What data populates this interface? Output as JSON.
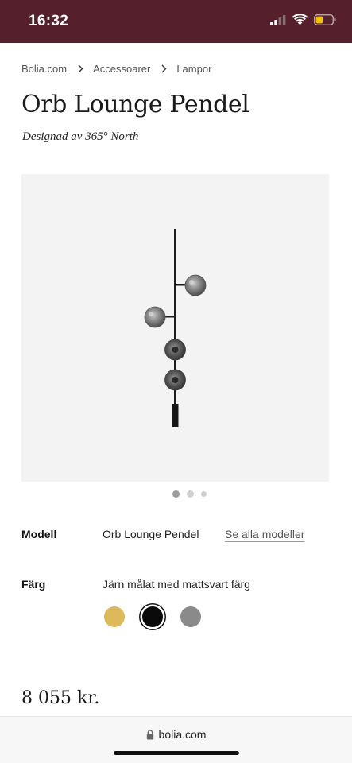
{
  "status_bar": {
    "time": "16:32",
    "battery_color": "#f2c200",
    "background": "#55202b"
  },
  "breadcrumb": {
    "items": [
      "Bolia.com",
      "Accessoarer",
      "Lampor"
    ]
  },
  "product": {
    "title": "Orb Lounge Pendel",
    "designer": "Designad av 365° North",
    "price": "8 055 kr."
  },
  "gallery": {
    "dots": 3,
    "active_index": 0
  },
  "options": {
    "model": {
      "label": "Modell",
      "value": "Orb Lounge Pendel",
      "link": "Se alla modeller"
    },
    "color": {
      "label": "Färg",
      "value": "Järn målat med mattsvart färg",
      "swatches": [
        {
          "color": "#dcb95a",
          "selected": false
        },
        {
          "color": "#0a0a0a",
          "selected": true
        },
        {
          "color": "#8a8a8a",
          "selected": false
        }
      ]
    }
  },
  "browser": {
    "url": "bolia.com",
    "lock_icon": "lock-icon"
  }
}
